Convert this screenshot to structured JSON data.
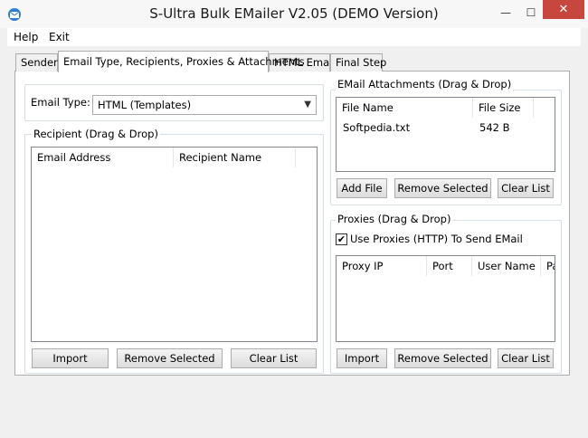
{
  "window": {
    "title": "S-Ultra Bulk EMailer V2.05 (DEMO Version)",
    "minimize_glyph": "—",
    "maximize_glyph": "☐",
    "close_glyph": "✕"
  },
  "menu": {
    "items": [
      "Help",
      "Exit"
    ]
  },
  "tabs": [
    {
      "label": "Sender",
      "active": false
    },
    {
      "label": "Email Type, Recipients, Proxies & Attachments",
      "active": true
    },
    {
      "label": "HTML Email",
      "active": false
    },
    {
      "label": "Final Step",
      "active": false
    }
  ],
  "email_type": {
    "label": "Email Type:",
    "selected": "HTML (Templates)"
  },
  "recipients": {
    "legend": "Recipient (Drag & Drop)",
    "columns": [
      "Email Address",
      "Recipient Name"
    ],
    "buttons": {
      "import": "Import",
      "remove": "Remove Selected",
      "clear": "Clear List"
    }
  },
  "attachments": {
    "legend": "EMail Attachments (Drag & Drop)",
    "columns": [
      "File Name",
      "File Size"
    ],
    "rows": [
      {
        "name": "Softpedia.txt",
        "size": "542 B"
      }
    ],
    "buttons": {
      "add": "Add File",
      "remove": "Remove Selected",
      "clear": "Clear List"
    }
  },
  "proxies": {
    "legend": "Proxies (Drag & Drop)",
    "use_proxies_label": "Use Proxies (HTTP) To Send EMail",
    "use_proxies_checked": true,
    "check_glyph": "✔",
    "columns": [
      "Proxy IP",
      "Port",
      "User Name",
      "Pa"
    ],
    "buttons": {
      "import": "Import",
      "remove": "Remove Selected",
      "clear": "Clear List"
    }
  }
}
